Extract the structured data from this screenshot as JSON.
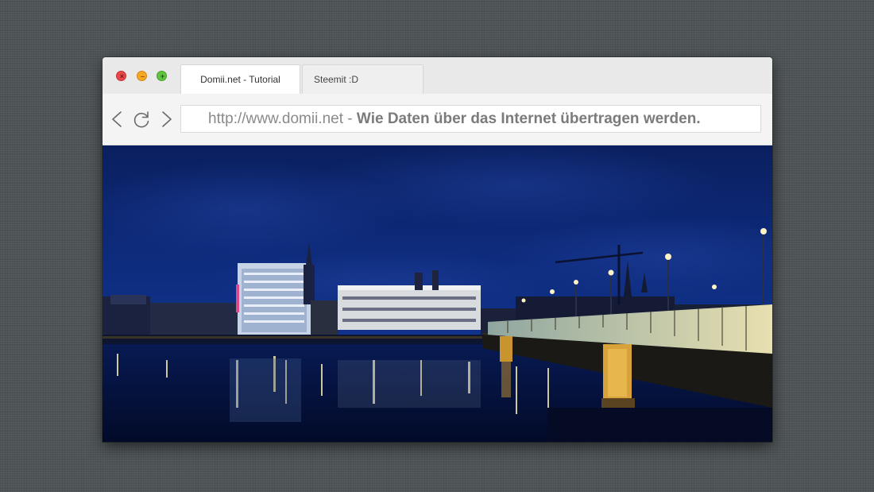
{
  "window": {
    "controls": {
      "close_icon": "close-icon",
      "minimize_icon": "minimize-icon",
      "maximize_icon": "plus-icon"
    },
    "tabs": [
      {
        "label": "Domii.net - Tutorial",
        "active": true
      },
      {
        "label": "Steemit :D",
        "active": false
      }
    ],
    "toolbar": {
      "back_icon": "arrow-left-icon",
      "reload_icon": "reload-icon",
      "forward_icon": "arrow-right-icon"
    },
    "address": {
      "host": "http://www.domii.net",
      "separator": " - ",
      "title": "Wie Daten über das Internet übertragen werden."
    }
  },
  "content": {
    "image_subject": "night-city-river-bridge-photo"
  },
  "colors": {
    "desktop_bg": "#4f5557",
    "close": "#e8474a",
    "minimize": "#f5a623",
    "maximize": "#61c43e",
    "sky": "#0d2a7a",
    "water": "#04103a"
  }
}
